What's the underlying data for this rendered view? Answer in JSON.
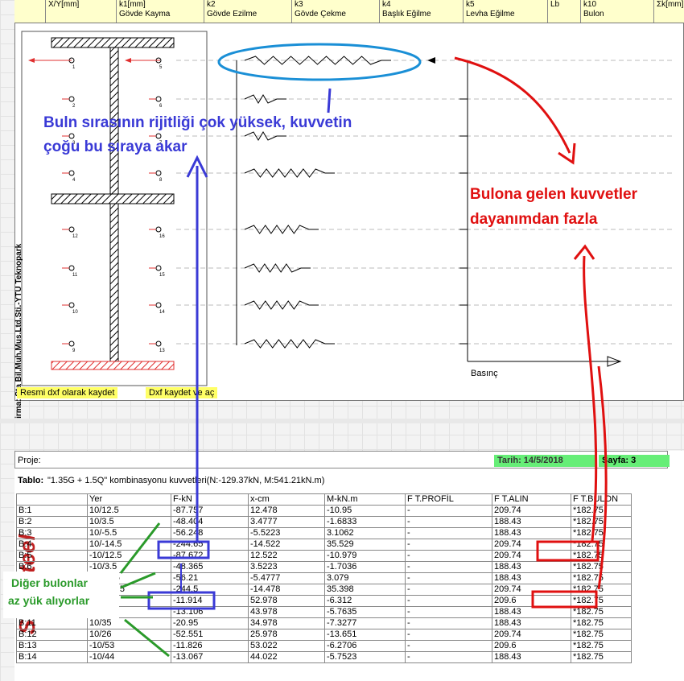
{
  "header": {
    "columns": [
      {
        "top": "X/Y[mm]",
        "sub": ""
      },
      {
        "top": "k1[mm]",
        "sub": "Gövde Kayma"
      },
      {
        "top": "k2",
        "sub": "Gövde Ezilme"
      },
      {
        "top": "k3",
        "sub": "Gövde Çekme"
      },
      {
        "top": "k4",
        "sub": "Başlık Eğilme"
      },
      {
        "top": "k5",
        "sub": "Levha Eğilme"
      },
      {
        "top": "Lb",
        "sub": ""
      },
      {
        "top": "k10",
        "sub": "Bulon"
      },
      {
        "top": "Σk[mm]",
        "sub": ""
      }
    ]
  },
  "drawing": {
    "firma": "Firma: Sta Bil.Muh.Mus.Ltd.Sti.-YTU Teknopark",
    "basinc_label": "Basınç",
    "bolt_numbers_left": [
      "1",
      "2",
      "3",
      "4",
      "12",
      "11",
      "10",
      "9"
    ],
    "bolt_numbers_right": [
      "5",
      "6",
      "7",
      "8",
      "16",
      "15",
      "14",
      "13"
    ]
  },
  "buttons": {
    "save_dxf": "Resmi dxf olarak kaydet",
    "save_open_dxf": "Dxf kaydet ve aç"
  },
  "annotations": {
    "blue_line1": "Buln sırasının rijitliği çok yüksek, kuvvetin",
    "blue_line2": "çoğu bu sıraya akar",
    "red_line1": "Bulona gelen kuvvetler",
    "red_line2": "dayanımdan fazla",
    "green_line1": "Diğer bulonlar",
    "green_line2": "az yük alıyorlar"
  },
  "report": {
    "proje_label": "Proje:",
    "tarih": "Tarih: 14/5/2018",
    "sayfa": "Sayfa: 3",
    "tablo_label": "Tablo:",
    "tablo_text": "\"1.35G  +  1.5Q\"   kombinasyonu kuvvetleri(N:-129.37kN,     M:541.21kN.m)",
    "logo": "STA steel",
    "columns": [
      "",
      "Yer",
      "F-kN",
      "x-cm",
      "M-kN.m",
      "F T.PROFİL",
      "F T.ALIN",
      "F T.BULON"
    ],
    "rows": [
      [
        "B:1",
        "10/12.5",
        "-87.757",
        "12.478",
        "-10.95",
        "-",
        "209.74",
        "*182.75"
      ],
      [
        "B:2",
        "10/3.5",
        "-48.404",
        "3.4777",
        "-1.6833",
        "-",
        "188.43",
        "*182.75"
      ],
      [
        "B:3",
        "10/-5.5",
        "-56.248",
        "-5.5223",
        "3.1062",
        "-",
        "188.43",
        "*182.75"
      ],
      [
        "B:4",
        "10/-14.5",
        "-244.65",
        "-14.522",
        "35.529",
        "-",
        "209.74",
        "*182.75"
      ],
      [
        "B:5",
        "-10/12.5",
        "-87.672",
        "12.522",
        "-10.979",
        "-",
        "209.74",
        "*182.75"
      ],
      [
        "B:6",
        "-10/3.5",
        "-48.365",
        "3.5223",
        "-1.7036",
        "-",
        "188.43",
        "*182.75"
      ],
      [
        "B:7",
        "-10/-5.5",
        "-56.21",
        "-5.4777",
        "3.079",
        "-",
        "188.43",
        "*182.75"
      ],
      [
        "B:8",
        "-10/-14.5",
        "-244.5",
        "-14.478",
        "35.398",
        "-",
        "209.74",
        "*182.75"
      ],
      [
        "B:9",
        "10/53",
        "-11.914",
        "52.978",
        "-6.312",
        "-",
        "209.6",
        "*182.75"
      ],
      [
        "B:10",
        "10/44",
        "-13.106",
        "43.978",
        "-5.7635",
        "-",
        "188.43",
        "*182.75"
      ],
      [
        "B:11",
        "10/35",
        "-20.95",
        "34.978",
        "-7.3277",
        "-",
        "188.43",
        "*182.75"
      ],
      [
        "B:12",
        "10/26",
        "-52.551",
        "25.978",
        "-13.651",
        "-",
        "209.74",
        "*182.75"
      ],
      [
        "B:13",
        "-10/53",
        "-11.826",
        "53.022",
        "-6.2706",
        "-",
        "209.6",
        "*182.75"
      ],
      [
        "B:14",
        "-10/44",
        "-13.067",
        "44.022",
        "-5.7523",
        "-",
        "188.43",
        "*182.75"
      ]
    ]
  },
  "colors": {
    "annot_blue": "#3a3ad6",
    "annot_red": "#e01010",
    "annot_green": "#2a9a2a",
    "header_bg": "#ffffcc",
    "date_bg": "#66ee77",
    "button_bg": "#ffff66"
  }
}
